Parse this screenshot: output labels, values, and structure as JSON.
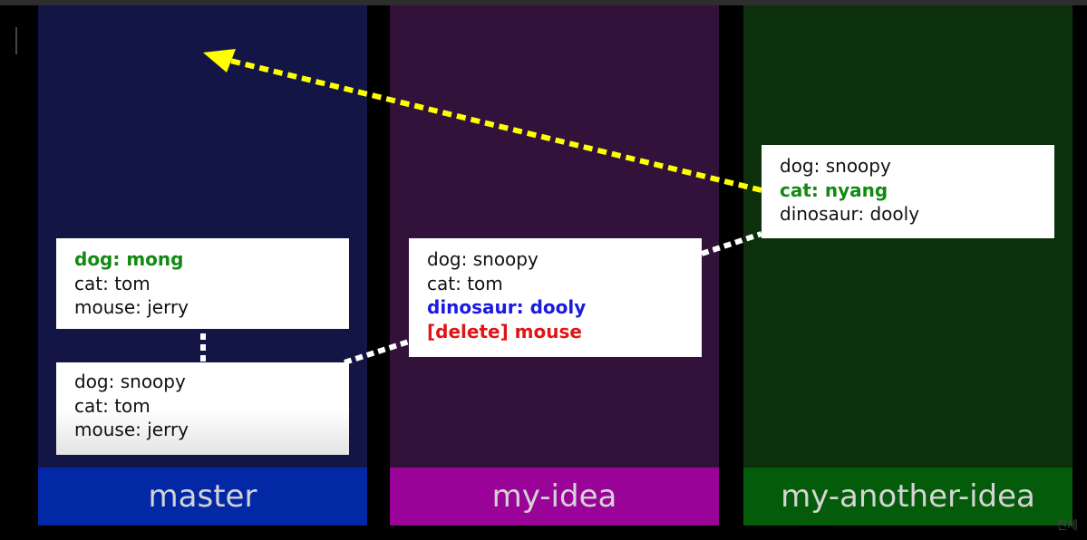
{
  "colors": {
    "master": "#131645",
    "my_idea": "#32123a",
    "my_another_idea": "#0c300c",
    "master_label_bg": "#0328a6",
    "my_idea_label_bg": "#9a0398",
    "my_another_idea_label_bg": "#045c0a",
    "arrow": "#ffff00",
    "connector": "#ffffff"
  },
  "branches": {
    "master": "master",
    "my_idea": "my-idea",
    "my_another_idea": "my-another-idea"
  },
  "cards": {
    "master_top": {
      "lines": [
        "dog: mong",
        "cat: tom",
        "mouse: jerry"
      ]
    },
    "master_base": {
      "lines": [
        "dog: snoopy",
        "cat: tom",
        "mouse: jerry"
      ]
    },
    "my_idea": {
      "lines": [
        "dog: snoopy",
        "cat: tom",
        "dinosaur: dooly",
        "[delete] mouse"
      ]
    },
    "my_another_idea": {
      "lines": [
        "dog: snoopy",
        "cat: nyang",
        "dinosaur: dooly"
      ]
    }
  },
  "watermark": "전체"
}
